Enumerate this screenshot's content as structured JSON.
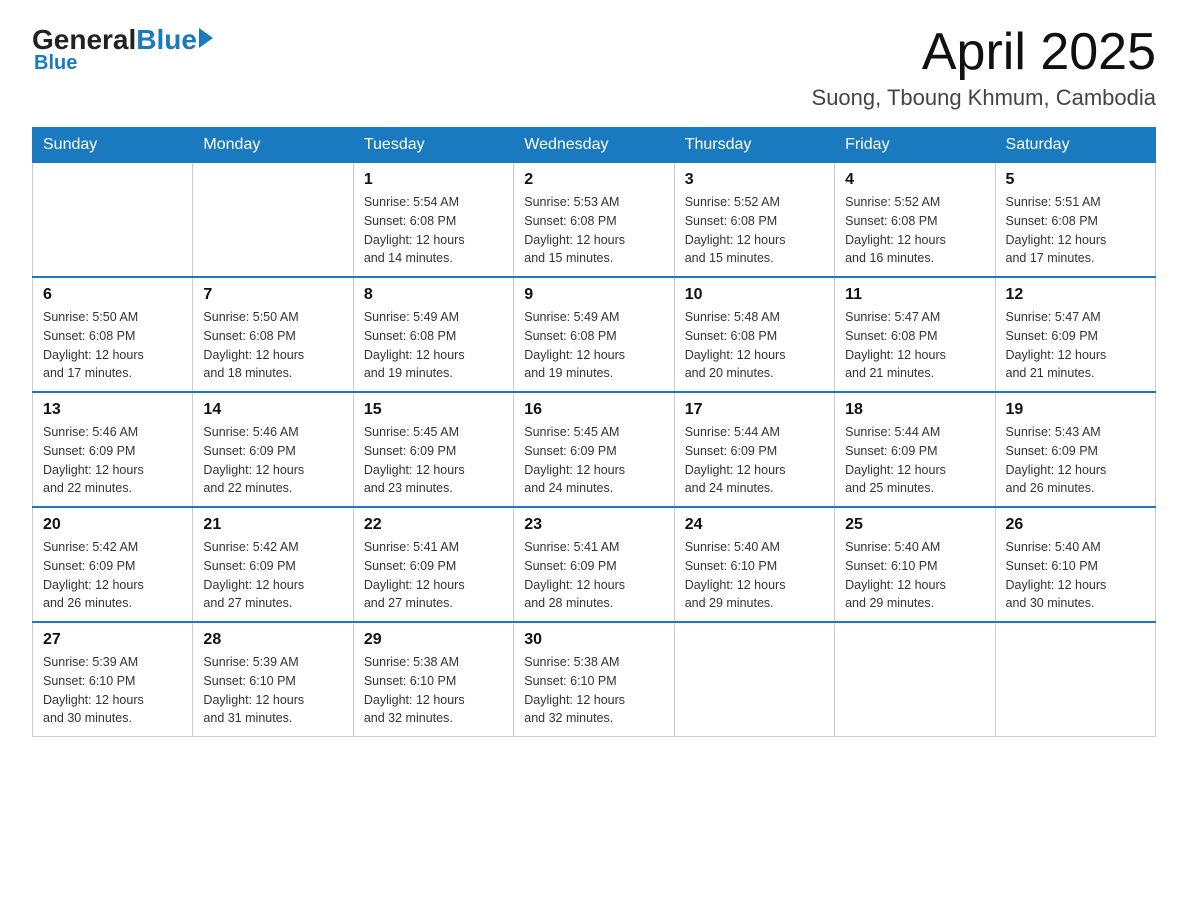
{
  "header": {
    "logo_general": "General",
    "logo_blue": "Blue",
    "month_title": "April 2025",
    "location": "Suong, Tboung Khmum, Cambodia"
  },
  "days_of_week": [
    "Sunday",
    "Monday",
    "Tuesday",
    "Wednesday",
    "Thursday",
    "Friday",
    "Saturday"
  ],
  "weeks": [
    [
      {
        "day": "",
        "info": ""
      },
      {
        "day": "",
        "info": ""
      },
      {
        "day": "1",
        "info": "Sunrise: 5:54 AM\nSunset: 6:08 PM\nDaylight: 12 hours\nand 14 minutes."
      },
      {
        "day": "2",
        "info": "Sunrise: 5:53 AM\nSunset: 6:08 PM\nDaylight: 12 hours\nand 15 minutes."
      },
      {
        "day": "3",
        "info": "Sunrise: 5:52 AM\nSunset: 6:08 PM\nDaylight: 12 hours\nand 15 minutes."
      },
      {
        "day": "4",
        "info": "Sunrise: 5:52 AM\nSunset: 6:08 PM\nDaylight: 12 hours\nand 16 minutes."
      },
      {
        "day": "5",
        "info": "Sunrise: 5:51 AM\nSunset: 6:08 PM\nDaylight: 12 hours\nand 17 minutes."
      }
    ],
    [
      {
        "day": "6",
        "info": "Sunrise: 5:50 AM\nSunset: 6:08 PM\nDaylight: 12 hours\nand 17 minutes."
      },
      {
        "day": "7",
        "info": "Sunrise: 5:50 AM\nSunset: 6:08 PM\nDaylight: 12 hours\nand 18 minutes."
      },
      {
        "day": "8",
        "info": "Sunrise: 5:49 AM\nSunset: 6:08 PM\nDaylight: 12 hours\nand 19 minutes."
      },
      {
        "day": "9",
        "info": "Sunrise: 5:49 AM\nSunset: 6:08 PM\nDaylight: 12 hours\nand 19 minutes."
      },
      {
        "day": "10",
        "info": "Sunrise: 5:48 AM\nSunset: 6:08 PM\nDaylight: 12 hours\nand 20 minutes."
      },
      {
        "day": "11",
        "info": "Sunrise: 5:47 AM\nSunset: 6:08 PM\nDaylight: 12 hours\nand 21 minutes."
      },
      {
        "day": "12",
        "info": "Sunrise: 5:47 AM\nSunset: 6:09 PM\nDaylight: 12 hours\nand 21 minutes."
      }
    ],
    [
      {
        "day": "13",
        "info": "Sunrise: 5:46 AM\nSunset: 6:09 PM\nDaylight: 12 hours\nand 22 minutes."
      },
      {
        "day": "14",
        "info": "Sunrise: 5:46 AM\nSunset: 6:09 PM\nDaylight: 12 hours\nand 22 minutes."
      },
      {
        "day": "15",
        "info": "Sunrise: 5:45 AM\nSunset: 6:09 PM\nDaylight: 12 hours\nand 23 minutes."
      },
      {
        "day": "16",
        "info": "Sunrise: 5:45 AM\nSunset: 6:09 PM\nDaylight: 12 hours\nand 24 minutes."
      },
      {
        "day": "17",
        "info": "Sunrise: 5:44 AM\nSunset: 6:09 PM\nDaylight: 12 hours\nand 24 minutes."
      },
      {
        "day": "18",
        "info": "Sunrise: 5:44 AM\nSunset: 6:09 PM\nDaylight: 12 hours\nand 25 minutes."
      },
      {
        "day": "19",
        "info": "Sunrise: 5:43 AM\nSunset: 6:09 PM\nDaylight: 12 hours\nand 26 minutes."
      }
    ],
    [
      {
        "day": "20",
        "info": "Sunrise: 5:42 AM\nSunset: 6:09 PM\nDaylight: 12 hours\nand 26 minutes."
      },
      {
        "day": "21",
        "info": "Sunrise: 5:42 AM\nSunset: 6:09 PM\nDaylight: 12 hours\nand 27 minutes."
      },
      {
        "day": "22",
        "info": "Sunrise: 5:41 AM\nSunset: 6:09 PM\nDaylight: 12 hours\nand 27 minutes."
      },
      {
        "day": "23",
        "info": "Sunrise: 5:41 AM\nSunset: 6:09 PM\nDaylight: 12 hours\nand 28 minutes."
      },
      {
        "day": "24",
        "info": "Sunrise: 5:40 AM\nSunset: 6:10 PM\nDaylight: 12 hours\nand 29 minutes."
      },
      {
        "day": "25",
        "info": "Sunrise: 5:40 AM\nSunset: 6:10 PM\nDaylight: 12 hours\nand 29 minutes."
      },
      {
        "day": "26",
        "info": "Sunrise: 5:40 AM\nSunset: 6:10 PM\nDaylight: 12 hours\nand 30 minutes."
      }
    ],
    [
      {
        "day": "27",
        "info": "Sunrise: 5:39 AM\nSunset: 6:10 PM\nDaylight: 12 hours\nand 30 minutes."
      },
      {
        "day": "28",
        "info": "Sunrise: 5:39 AM\nSunset: 6:10 PM\nDaylight: 12 hours\nand 31 minutes."
      },
      {
        "day": "29",
        "info": "Sunrise: 5:38 AM\nSunset: 6:10 PM\nDaylight: 12 hours\nand 32 minutes."
      },
      {
        "day": "30",
        "info": "Sunrise: 5:38 AM\nSunset: 6:10 PM\nDaylight: 12 hours\nand 32 minutes."
      },
      {
        "day": "",
        "info": ""
      },
      {
        "day": "",
        "info": ""
      },
      {
        "day": "",
        "info": ""
      }
    ]
  ]
}
